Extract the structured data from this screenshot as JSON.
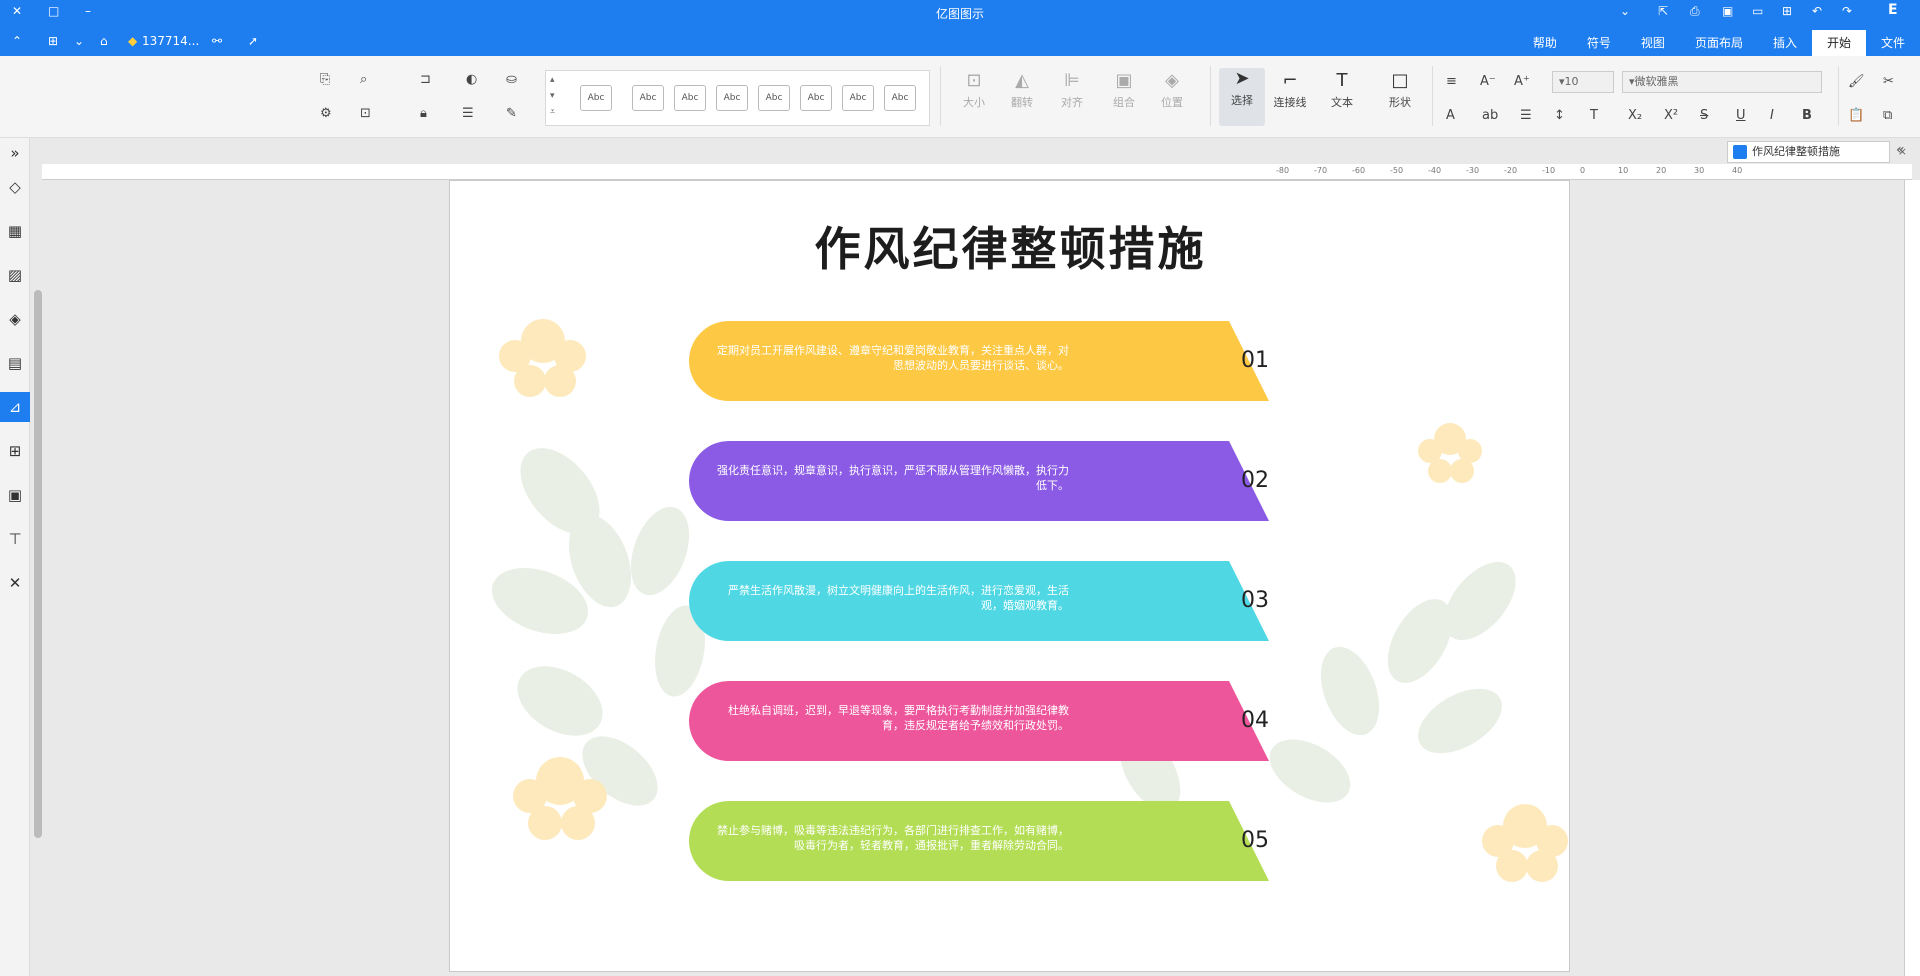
{
  "window": {
    "title": "亿图图示",
    "user": "137714...",
    "controls": {
      "minimize": "–",
      "restore": "□",
      "close": "✕"
    }
  },
  "tabs": [
    {
      "label": "文件",
      "active": false
    },
    {
      "label": "开始",
      "active": true
    },
    {
      "label": "插入",
      "active": false
    },
    {
      "label": "页面布局",
      "active": false
    },
    {
      "label": "视图",
      "active": false
    },
    {
      "label": "符号",
      "active": false
    },
    {
      "label": "帮助",
      "active": false
    }
  ],
  "ribbon": {
    "font_name": "微软雅黑",
    "font_size": "10",
    "shape_label": "形状",
    "text_label": "文本",
    "connector_label": "连接线",
    "select_label": "选择",
    "position_label": "位置",
    "group_label": "组合",
    "align_label": "对齐",
    "flip_label": "翻转",
    "size_label": "大小",
    "style_samples": [
      "Abc",
      "Abc",
      "Abc",
      "Abc",
      "Abc",
      "Abc",
      "Abc",
      "Abc"
    ]
  },
  "document_tab": {
    "label": "作风纪律整顿措施",
    "close": "×"
  },
  "ruler_ticks": [
    "40",
    "30",
    "20",
    "10",
    "0",
    "-10",
    "-20",
    "-30",
    "-40",
    "-50",
    "-60",
    "-70",
    "-80"
  ],
  "page": {
    "title": "作风纪律整顿措施",
    "items": [
      {
        "number": "01",
        "text": "定期对员工开展作风建设、遵章守纪和爱岗敬业教育，关注重点人群，对思想波动的人员要进行谈话、谈心。",
        "color": "#FDC843"
      },
      {
        "number": "02",
        "text": "强化责任意识，规章意识，执行意识，严惩不服从管理作风懒散，执行力低下。",
        "color": "#8B5BE6"
      },
      {
        "number": "03",
        "text": "严禁生活作风散漫，树立文明健康向上的生活作风，进行恋爱观，生活观，婚姻观教育。",
        "color": "#4FD8E4"
      },
      {
        "number": "04",
        "text": "杜绝私自调班，迟到，早退等现象，要严格执行考勤制度并加强纪律教育，违反规定者给予绩效和行政处罚。",
        "color": "#EE569B"
      },
      {
        "number": "05",
        "text": "禁止参与赌博，吸毒等违法违纪行为，各部门进行排查工作，如有赌博，吸毒行为者，轻者教育，通报批评，重者解除劳动合同。",
        "color": "#B3DD55"
      }
    ]
  },
  "icons": {
    "sidebar": [
      "collapse-icon",
      "fill-icon",
      "shapes-icon",
      "image-icon",
      "layers-icon",
      "page-icon",
      "chart-icon",
      "table-icon",
      "widget-icon",
      "format-icon",
      "layout-icon"
    ]
  }
}
